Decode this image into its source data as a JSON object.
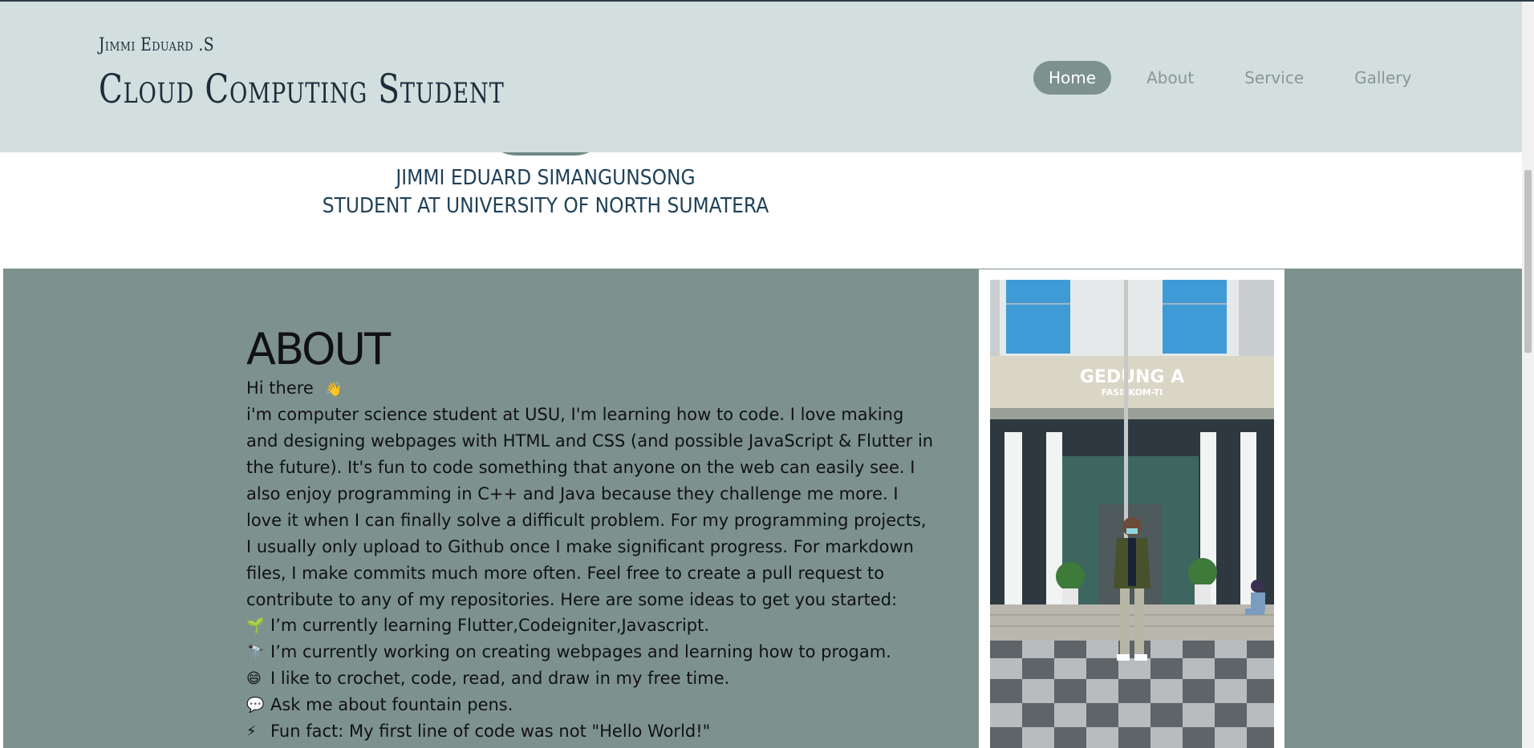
{
  "header": {
    "brand_small": "Jimmi Eduard .S",
    "brand_big": "Cloud Computing Student",
    "nav": [
      "Home",
      "About",
      "Service",
      "Gallery"
    ]
  },
  "profile": {
    "name": "JIMMI EDUARD SIMANGUNSONG",
    "role": "STUDENT AT UNIVERSITY OF NORTH SUMATERA"
  },
  "about": {
    "title": "ABOUT",
    "greeting": "Hi there",
    "greeting_emoji": "👋",
    "body": "i'm computer science student at USU, I'm learning how to code. I love making and designing webpages with HTML and CSS (and possible JavaScript & Flutter in the future). It's fun to code something that anyone on the web can easily see. I also enjoy programming in C++ and Java because they challenge me more. I love it when I can finally solve a difficult problem. For my programming projects, I usually only upload to Github once I make significant progress. For markdown files, I make commits much more often. Feel free to create a pull request to contribute to any of my repositories. Here are some ideas to get you started:",
    "items": [
      {
        "emoji": "🌱",
        "text": "I’m currently learning Flutter,Codeigniter,Javascript."
      },
      {
        "emoji": "🔭",
        "text": "I’m currently working on creating webpages and learning how to progam."
      },
      {
        "emoji": "😄",
        "text": "I like to crochet, code, read, and draw in my free time."
      },
      {
        "emoji": "💬",
        "text": "Ask me about fountain pens."
      },
      {
        "emoji": "⚡",
        "text": "Fun fact: My first line of code was not \"Hello World!\""
      }
    ],
    "photo_sign_line1": "GEDUNG A",
    "photo_sign_line2": "FASILKOM-TI"
  },
  "colors": {
    "header_bg": "#d2dfde",
    "nav_active": "#7d928e",
    "about_bg": "#7d928e",
    "name_text": "#1f4158"
  }
}
